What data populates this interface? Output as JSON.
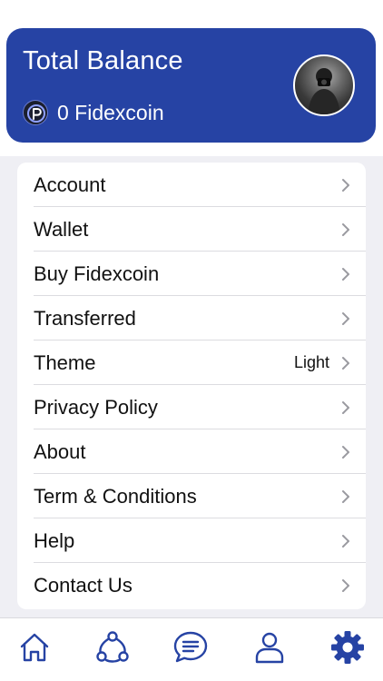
{
  "balance": {
    "title": "Total Balance",
    "amount": "0 Fidexcoin",
    "coin_icon": "fidexcoin-logo",
    "avatar": "user-avatar"
  },
  "menu": {
    "items": [
      {
        "label": "Account",
        "value": ""
      },
      {
        "label": "Wallet",
        "value": ""
      },
      {
        "label": "Buy Fidexcoin",
        "value": ""
      },
      {
        "label": "Transferred",
        "value": ""
      },
      {
        "label": "Theme",
        "value": "Light"
      },
      {
        "label": "Privacy Policy",
        "value": ""
      },
      {
        "label": "About",
        "value": ""
      },
      {
        "label": "Term & Conditions",
        "value": ""
      },
      {
        "label": "Help",
        "value": ""
      },
      {
        "label": "Contact Us",
        "value": ""
      }
    ]
  },
  "tabbar": {
    "tabs": [
      {
        "icon": "home-icon",
        "active": false
      },
      {
        "icon": "network-icon",
        "active": false
      },
      {
        "icon": "chat-icon",
        "active": false
      },
      {
        "icon": "profile-icon",
        "active": false
      },
      {
        "icon": "gear-icon",
        "active": true
      }
    ]
  },
  "colors": {
    "brand": "#2643a4",
    "list_background": "#efeff4",
    "chevron": "#9a9aa0"
  }
}
